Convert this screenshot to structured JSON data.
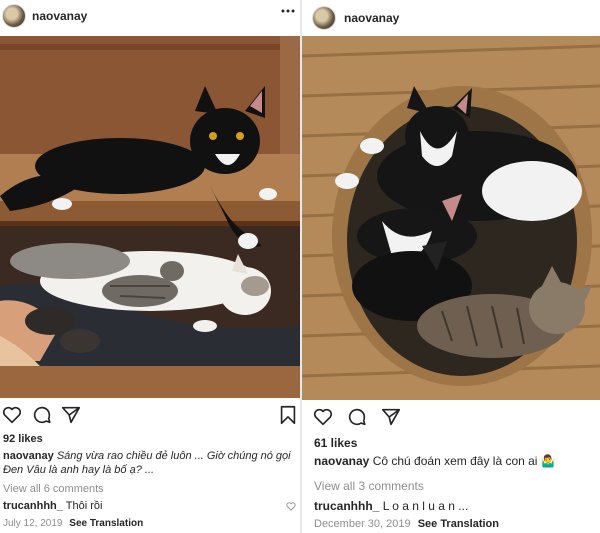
{
  "left_post": {
    "username": "naovanay",
    "more_icon": "ellipsis-horizontal-icon",
    "likes": "92 likes",
    "caption_user": "naovanay",
    "caption_text": "Sáng vừa rao chiều đẻ luôn ... Giờ chúng nó gọi Đen Vâu là anh hay là bố ạ? ...",
    "view_comments": "View all 6 comments",
    "comment_user": "trucanhhh_",
    "comment_text": "Thôi rồi",
    "date": "July 12, 2019",
    "translate": "See Translation",
    "icons": [
      "heart-icon",
      "comment-icon",
      "share-icon",
      "bookmark-icon"
    ]
  },
  "right_post": {
    "username": "naovanay",
    "likes": "61 likes",
    "caption_user": "naovanay",
    "caption_text": "Cô chú đoán xem đây là con ai",
    "caption_emoji": "🤷‍♂️",
    "view_comments": "View all 3 comments",
    "comment_user": "trucanhhh_",
    "comment_text": "L o a n l u a n ...",
    "date": "December 30, 2019",
    "translate": "See Translation",
    "icons": [
      "heart-icon",
      "comment-icon",
      "share-icon"
    ]
  }
}
